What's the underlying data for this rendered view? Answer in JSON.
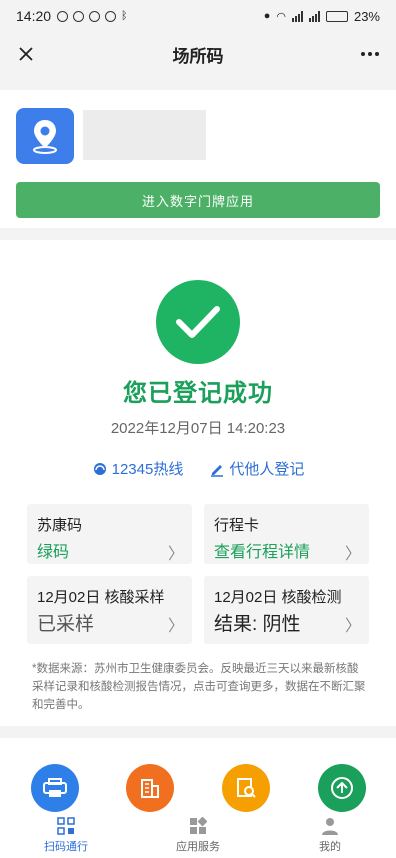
{
  "status_bar": {
    "time": "14:20",
    "network": "4G",
    "battery": "23%"
  },
  "title_bar": {
    "title": "场所码",
    "close_icon": "close-icon",
    "more_icon": "more-icon"
  },
  "venue": {
    "icon": "location-pin-icon",
    "enter_button": "进入数字门牌应用"
  },
  "registration": {
    "success_text": "您已登记成功",
    "timestamp": "2022年12月07日  14:20:23",
    "hotline_label": "12345热线",
    "proxy_label": "代他人登记"
  },
  "tiles": [
    {
      "title": "苏康码",
      "value": "绿码"
    },
    {
      "title": "行程卡",
      "value": "查看行程详情"
    },
    {
      "title": "12月02日 核酸采样",
      "value": "已采样"
    },
    {
      "title": "12月02日 核酸检测",
      "value": "结果: 阴性"
    }
  ],
  "note": "*数据来源：苏州市卫生健康委员会。反映最近三天以来最新核酸采样记录和核酸检测报告情况，点击可查询更多，数据在不断汇聚和完善中。",
  "colors": {
    "green": "#1aa05a",
    "blue": "#2d6fd6",
    "button_green": "#4cb067"
  },
  "tabbar": {
    "items": [
      {
        "label": "扫码通行"
      },
      {
        "label": "应用服务"
      },
      {
        "label": "我的"
      }
    ]
  }
}
